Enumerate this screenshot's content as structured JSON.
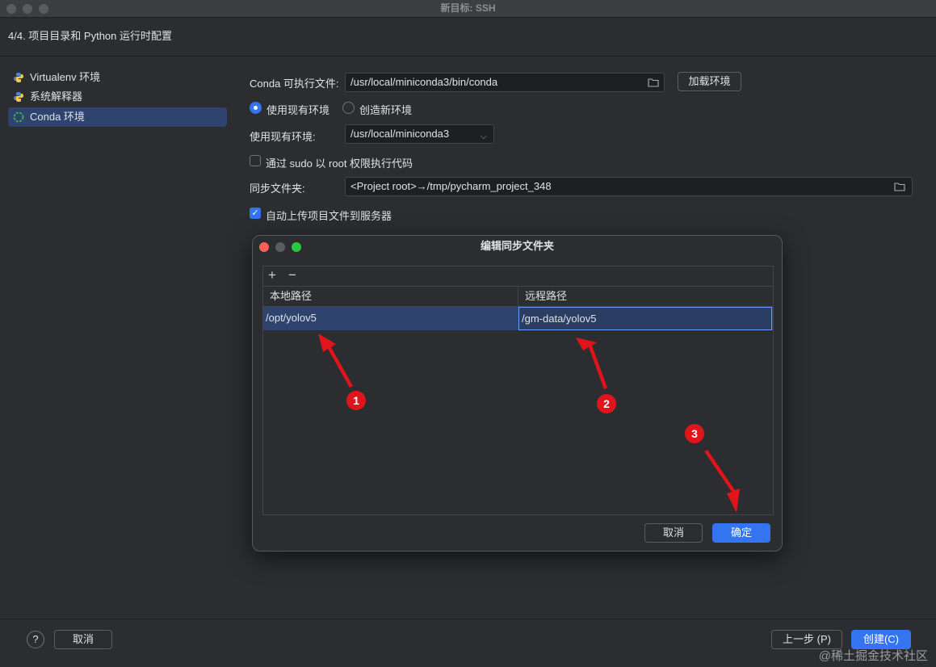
{
  "window": {
    "title": "新目标: SSH"
  },
  "step": {
    "title": "4/4. 项目目录和 Python 运行时配置"
  },
  "sidebar": {
    "items": [
      {
        "label": "Virtualenv 环境",
        "icon": "python-icon"
      },
      {
        "label": "系统解释器",
        "icon": "python-icon"
      },
      {
        "label": "Conda 环境",
        "icon": "conda-icon",
        "selected": true
      }
    ]
  },
  "form": {
    "conda_label": "Conda 可执行文件:",
    "conda_path": "/usr/local/miniconda3/bin/conda",
    "load_env_button": "加载环境",
    "radio_existing": "使用现有环境",
    "radio_new": "创造新环境",
    "existing_env_label": "使用现有环境:",
    "existing_env_value": "/usr/local/miniconda3",
    "sudo_label": "通过 sudo 以 root 权限执行代码",
    "sync_label": "同步文件夹:",
    "sync_value": "<Project root>→/tmp/pycharm_project_348",
    "auto_upload_label": "自动上传项目文件到服务器"
  },
  "dialog": {
    "title": "编辑同步文件夹",
    "toolbar": {
      "add": "+",
      "remove": "−"
    },
    "columns": [
      "本地路径",
      "远程路径"
    ],
    "rows": [
      {
        "local": "/opt/yolov5",
        "remote": "/gm-data/yolov5"
      }
    ],
    "cancel": "取消",
    "ok": "确定"
  },
  "annotations": [
    "1",
    "2",
    "3"
  ],
  "footer": {
    "help": "?",
    "cancel": "取消",
    "prev": "上一步 (P)",
    "create": "创建(C)"
  },
  "watermark": "@稀土掘金技术社区",
  "colors": {
    "accent": "#3574f0",
    "selection": "#2e436e",
    "annotation": "#e0151b"
  }
}
